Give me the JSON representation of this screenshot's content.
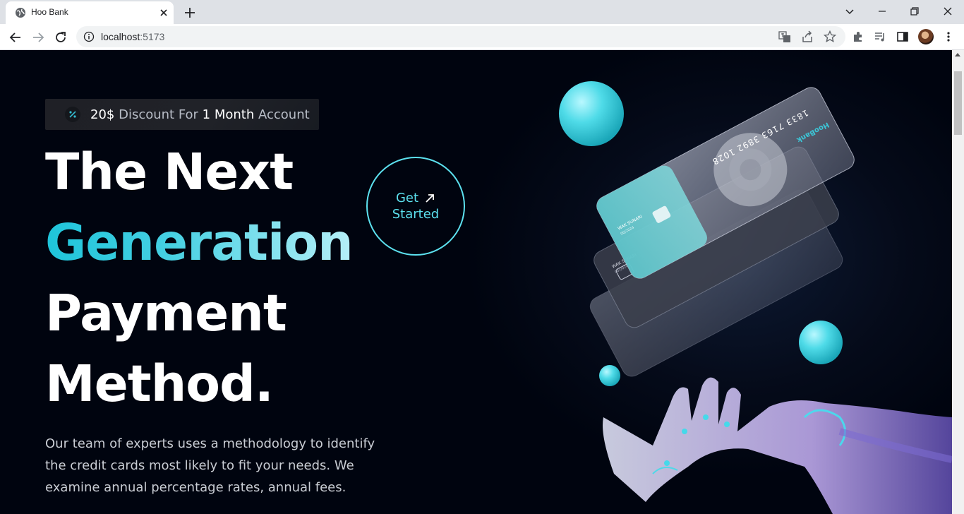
{
  "browser": {
    "tab_title": "Hoo Bank",
    "url_host": "localhost",
    "url_port": ":5173"
  },
  "hero": {
    "badge": {
      "amount": "20$",
      "pre": " Discount For ",
      "duration": "1 Month",
      "post": " Account"
    },
    "headline": {
      "line1": "The Next",
      "line2": "Generation",
      "line3": "Payment",
      "line4": "Method."
    },
    "paragraph": "Our team of experts uses a methodology to identify the credit cards most likely to fit your needs. We examine annual percentage rates, annual fees.",
    "cta": {
      "line1": "Get",
      "line2": "Started"
    }
  },
  "card": {
    "number": "1833 7163 3892 1028",
    "brand": "HooBank",
    "holder": "WAK SUNARI",
    "expiry": "00/2024"
  },
  "colors": {
    "background": "#00040f",
    "accent": "#5ce1ef",
    "gradient_start": "#1ec4da",
    "gradient_end": "#b6f0f8"
  }
}
